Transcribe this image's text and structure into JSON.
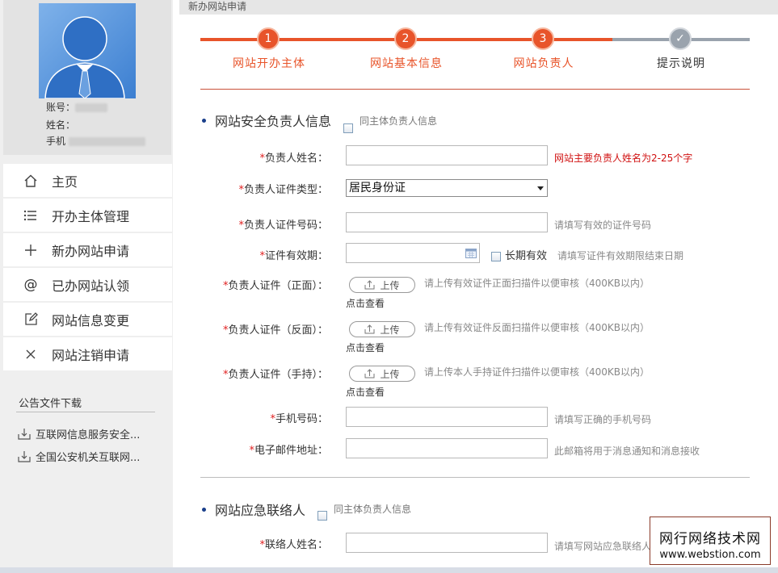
{
  "profile": {
    "account_label": "账号：",
    "name_label": "姓名：",
    "phone_label": "手机"
  },
  "nav": {
    "items": [
      {
        "label": "主页",
        "icon": "home-icon"
      },
      {
        "label": "开办主体管理",
        "icon": "list-icon"
      },
      {
        "label": "新办网站申请",
        "icon": "plus-icon"
      },
      {
        "label": "已办网站认领",
        "icon": "at-icon"
      },
      {
        "label": "网站信息变更",
        "icon": "edit-icon"
      },
      {
        "label": "网站注销申请",
        "icon": "close-icon"
      }
    ]
  },
  "notices": {
    "title": "公告文件下载",
    "items": [
      "互联网信息服务安全...",
      "全国公安机关互联网..."
    ]
  },
  "header": {
    "title": "新办网站申请"
  },
  "steps": [
    {
      "num": "1",
      "label": "网站开办主体",
      "state": "done"
    },
    {
      "num": "2",
      "label": "网站基本信息",
      "state": "done"
    },
    {
      "num": "3",
      "label": "网站负责人",
      "state": "current"
    },
    {
      "num": "✓",
      "label": "提示说明",
      "state": "pending"
    }
  ],
  "colors": {
    "accent": "#e8542a",
    "pending": "#9aa3ad",
    "required": "#e02020"
  },
  "security_section": {
    "title": "网站安全负责人信息",
    "same_as_label": "同主体负责人信息",
    "fields": {
      "name_label": "负责人姓名：",
      "name_hint": "网站主要负责人姓名为2-25个字",
      "id_type_label": "负责人证件类型：",
      "id_type_value": "居民身份证",
      "id_number_label": "负责人证件号码：",
      "id_number_hint": "请填写有效的证件号码",
      "validity_label": "证件有效期：",
      "long_term_label": "长期有效",
      "validity_hint": "请填写证件有效期限结束日期",
      "front_label": "负责人证件（正面）：",
      "front_hint": "请上传有效证件正面扫描件以便审核（400KB以内）",
      "back_label": "负责人证件（反面）：",
      "back_hint": "请上传有效证件反面扫描件以便审核（400KB以内）",
      "hold_label": "负责人证件（手持）：",
      "hold_hint": "请上传本人手持证件扫描件以便审核（400KB以内）",
      "upload_label": "上传",
      "view_label": "点击查看",
      "phone_label": "手机号码：",
      "phone_hint": "请填写正确的手机号码",
      "email_label": "电子邮件地址：",
      "email_hint": "此邮箱将用于消息通知和消息接收"
    }
  },
  "emergency_section": {
    "title": "网站应急联络人",
    "same_as_label": "同主体负责人信息",
    "contact_name_label": "联络人姓名：",
    "contact_name_hint": "请填写网站应急联络人姓名"
  },
  "watermark": {
    "line1": "网行网络技术网",
    "line2": "www.webstion.com"
  }
}
